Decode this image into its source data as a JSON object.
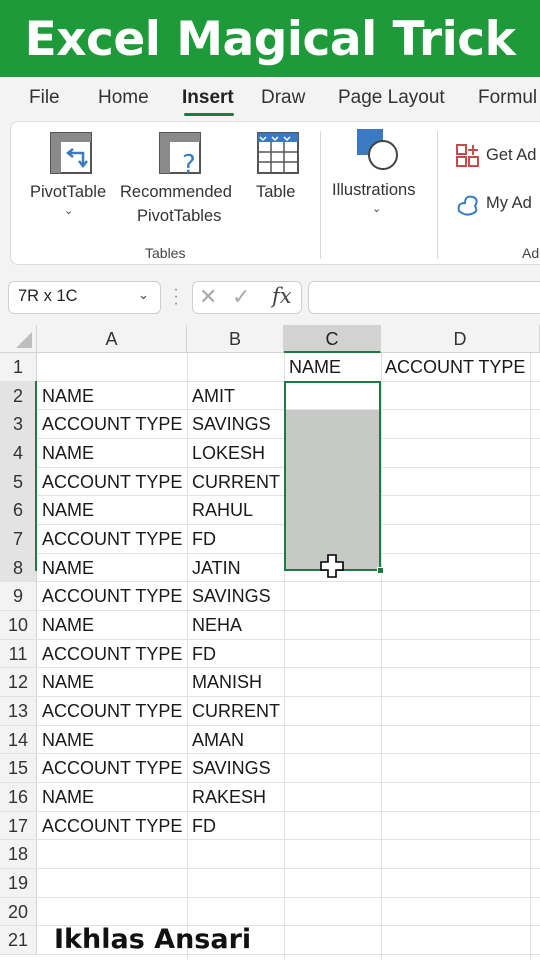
{
  "banner": {
    "title": "Excel Magical Trick"
  },
  "tabs": [
    "File",
    "Home",
    "Insert",
    "Draw",
    "Page Layout",
    "Formul"
  ],
  "ribbon": {
    "pivot_table": "PivotTable",
    "recommended_1": "Recommended",
    "recommended_2": "PivotTables",
    "table": "Table",
    "illustrations": "Illustrations",
    "get_addins": "Get Ad",
    "my_addins": "My Ad",
    "group_tables": "Tables",
    "group_addins": "Ad",
    "chevron": "⌄"
  },
  "formula_bar": {
    "name_box": "7R x 1C",
    "name_box_chevron": "⌄",
    "cancel": "✕",
    "enter": "✓",
    "fx": "fx",
    "value": ""
  },
  "columns": [
    "A",
    "B",
    "C",
    "D"
  ],
  "rows": [
    "1",
    "2",
    "3",
    "4",
    "5",
    "6",
    "7",
    "8",
    "9",
    "10",
    "11",
    "12",
    "13",
    "14",
    "15",
    "16",
    "17",
    "18",
    "19",
    "20",
    "21"
  ],
  "cells": {
    "C1": "NAME",
    "D1": "ACCOUNT TYPE",
    "A": [
      "",
      "NAME",
      "ACCOUNT TYPE",
      "NAME",
      "ACCOUNT TYPE",
      "NAME",
      "ACCOUNT TYPE",
      "NAME",
      "ACCOUNT TYPE",
      "NAME",
      "ACCOUNT TYPE",
      "NAME",
      "ACCOUNT TYPE",
      "NAME",
      "ACCOUNT TYPE",
      "NAME",
      "ACCOUNT TYPE"
    ],
    "B": [
      "",
      "AMIT",
      "SAVINGS",
      "LOKESH",
      "CURRENT",
      "RAHUL",
      "FD",
      "JATIN",
      "SAVINGS",
      "NEHA",
      "FD",
      "MANISH",
      "CURRENT",
      "AMAN",
      "SAVINGS",
      "RAKESH",
      "FD"
    ]
  },
  "selection": {
    "range": "C2:C8",
    "active_column": "C"
  },
  "watermark": "Ikhlas Ansari",
  "colors": {
    "banner": "#1f9a3a",
    "accent": "#1f7a3f",
    "selection_fill": "#c6c9c5"
  }
}
